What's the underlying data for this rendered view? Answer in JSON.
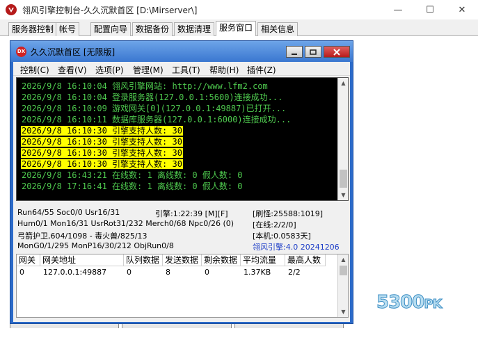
{
  "window": {
    "title": "翎风引擎控制台-久久沉默首区 [D:\\Mirserver\\]",
    "min_glyph": "—",
    "max_glyph": "☐",
    "close_glyph": "✕"
  },
  "tabs": [
    "服务器控制",
    "帐号",
    "配置向导",
    "数据备份",
    "数据清理",
    "服务窗口",
    "相关信息"
  ],
  "active_tab": "服务窗口",
  "watermark": {
    "main": "5300",
    "suffix": "PK"
  },
  "inner_window": {
    "icon_text": "DX",
    "title": "久久沉默首区 [无限版]",
    "menu": [
      "控制(C)",
      "查看(V)",
      "选项(P)",
      "管理(M)",
      "工具(T)",
      "帮助(H)",
      "插件(Z)"
    ]
  },
  "log": [
    {
      "text": "2026/9/8 16:10:04 翎风引擎网站: http://www.lfm2.com",
      "highlight": false
    },
    {
      "text": "2026/9/8 16:10:04 登录服务器(127.0.0.1:5600)连接成功...",
      "highlight": false
    },
    {
      "text": "2026/9/8 16:10:09 游戏网关[0](127.0.0.1:49887)已打开...",
      "highlight": false
    },
    {
      "text": "2026/9/8 16:10:11 数据库服务器(127.0.0.1:6000)连接成功...",
      "highlight": false
    },
    {
      "text": "2026/9/8 16:10:30 引擎支持人数: 30",
      "highlight": true
    },
    {
      "text": "2026/9/8 16:10:30 引擎支持人数: 30",
      "highlight": true
    },
    {
      "text": "2026/9/8 16:10:30 引擎支持人数: 30",
      "highlight": true
    },
    {
      "text": "2026/9/8 16:10:30 引擎支持人数: 30",
      "highlight": true
    },
    {
      "text": "2026/9/8 16:43:21 在线数: 1 离线数: 0 假人数: 0",
      "highlight": false
    },
    {
      "text": "2026/9/8 17:16:41 在线数: 1 离线数: 0 假人数: 0",
      "highlight": false
    }
  ],
  "status": {
    "run": "Run64/55 Soc0/0 Usr16/31",
    "engine": "引擎:1:22:39 [M][F]",
    "refresh": "[刷怪:25588:1019]",
    "hum": "Hum0/1 Mon16/31 UsrRot31/232 Merch0/68 Npc0/26 (0)",
    "online": "[在线:2/2/0]",
    "player": "弓箭护卫,604/1098 - 毒火兽/825/13",
    "machine": "[本机:0.0583天]",
    "mongo": "MonG0/1/295 MonP16/30/212 ObjRun0/8",
    "version": "翎风引擎:4.0 20241206"
  },
  "gateway_table": {
    "headers": [
      "网关",
      "网关地址",
      "队列数据",
      "发送数据",
      "剩余数据",
      "平均流量",
      "最高人数"
    ],
    "rows": [
      [
        "0",
        "127.0.0.1:49887",
        "0",
        "8",
        "0",
        "1.37KB",
        "2/2"
      ]
    ]
  },
  "colors": {
    "console_bg": "#000000",
    "console_text": "#4ec94e",
    "highlight_bg": "#ffff00",
    "inner_frame": "#2c6bc9",
    "version_text": "#1a3bc7"
  }
}
